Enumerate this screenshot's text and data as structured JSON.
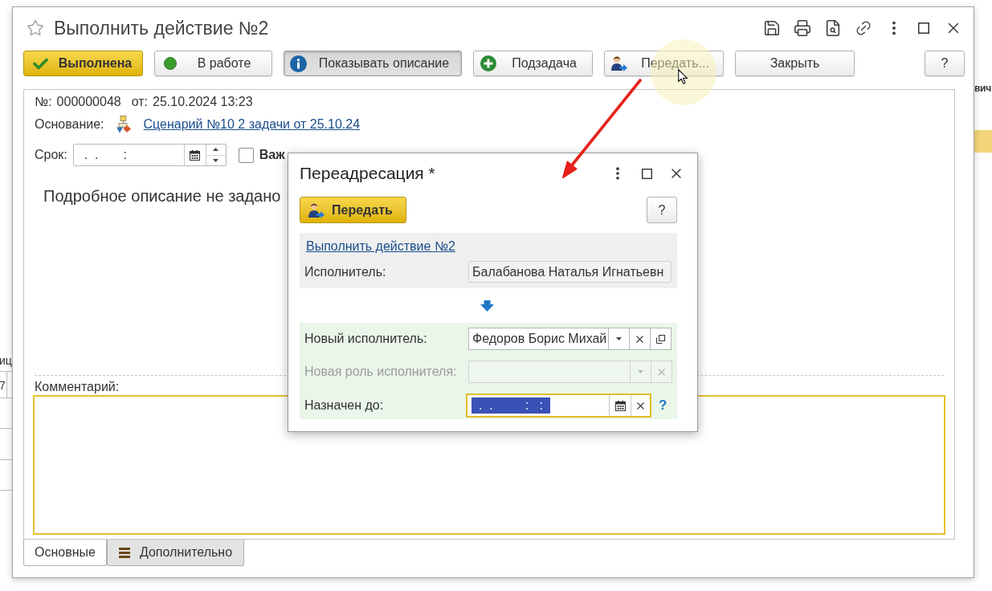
{
  "background": {
    "right_text": "вич",
    "left_texts": [
      "иц",
      "7"
    ]
  },
  "window": {
    "title": "Выполнить действие №2",
    "favorite": false
  },
  "toolbar": [
    {
      "label": "Выполнена",
      "kind": "done",
      "pressed": false
    },
    {
      "label": "В работе",
      "kind": "status",
      "pressed": false
    },
    {
      "label": "Показывать описание",
      "kind": "info",
      "pressed": true
    },
    {
      "label": "Подзадача",
      "kind": "subtask",
      "pressed": false
    },
    {
      "label": "Передать...",
      "kind": "forward",
      "pressed": false
    },
    {
      "label": "Закрыть",
      "kind": "close",
      "pressed": false
    },
    {
      "label": "?",
      "kind": "help",
      "pressed": false
    }
  ],
  "form": {
    "number_label": "№:",
    "number": "000000048",
    "date_label": "от:",
    "date": "25.10.2024 13:23",
    "basis_label": "Основание:",
    "basis_link": "Сценарий №10 2 задачи от 25.10.24",
    "deadline_label": "Срок:",
    "deadline_value": "  .  .       :",
    "important": {
      "label": "Важ",
      "checked": false
    },
    "description": "Подробное описание не задано",
    "comment": {
      "label": "Комментарий:",
      "focused": true
    },
    "tabs": [
      {
        "label": "Основные",
        "kind": "plain",
        "selected": true
      },
      {
        "label": "Дополнительно",
        "kind": "menu",
        "selected": false
      }
    ]
  },
  "dialog": {
    "title": "Переадресация *",
    "submit": "Передать",
    "help": "?",
    "task_link": "Выполнить действие №2",
    "current": {
      "label": "Исполнитель:",
      "value": "Балабанова Наталья Игнатьевн"
    },
    "fields": [
      {
        "label": "Новый исполнитель:",
        "value": "Федоров Борис Михай",
        "kind": "reference",
        "disabled": false,
        "focused": false
      },
      {
        "label": "Новая роль исполнителя:",
        "kind": "choice",
        "disabled": true,
        "focused": false
      },
      {
        "label": "Назначен до:",
        "value": "  .  .         :   :  ",
        "kind": "date",
        "disabled": false,
        "focused": true,
        "selected": true,
        "hint": "?"
      }
    ]
  }
}
